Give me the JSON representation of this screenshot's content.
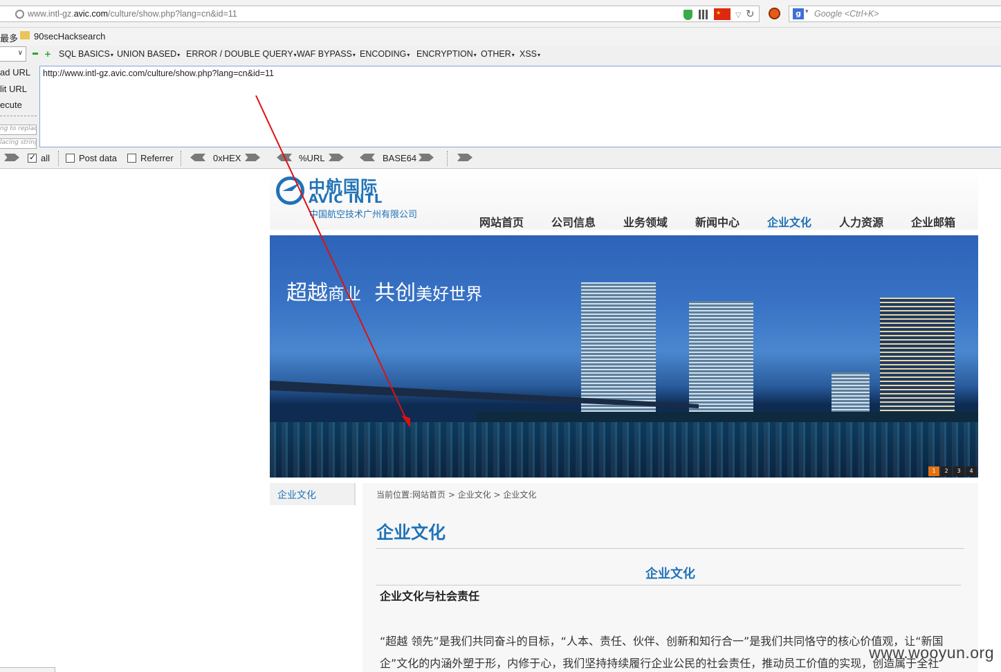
{
  "browser": {
    "url_prefix": "www.intl-gz.",
    "url_domain": "avic.com",
    "url_path": "/culture/show.php?lang=cn&id=11",
    "search_placeholder": "Google <Ctrl+K>",
    "search_engine_icon": "google-icon"
  },
  "bookmarks": {
    "more_label": "最多",
    "items": [
      "90secHacksearch"
    ]
  },
  "hackbar": {
    "menus": [
      "SQL BASICS",
      "UNION BASED",
      "ERROR / DOUBLE QUERY",
      "WAF BYPASS",
      "ENCODING",
      "ENCRYPTION",
      "OTHER",
      "XSS"
    ],
    "side_actions": [
      "ad URL",
      "lit URL",
      "ecute"
    ],
    "find_placeholder": "ng to replac",
    "replace_placeholder": "lacing string",
    "url_value": "http://www.intl-gz.avic.com/culture/show.php?lang=cn&id=11",
    "all_label": "all",
    "all_checked": true,
    "post_label": "Post data",
    "post_checked": false,
    "referrer_label": "Referrer",
    "referrer_checked": false,
    "encoders": [
      "0xHEX",
      "%URL",
      "BASE64"
    ]
  },
  "site": {
    "logo_cn": "中航国际",
    "logo_en": "AVIC INTL",
    "logo_sub": "中国航空技术广州有限公司",
    "nav": [
      "网站首页",
      "公司信息",
      "业务领域",
      "新闻中心",
      "企业文化",
      "人力资源",
      "企业邮箱"
    ],
    "nav_active": "企业文化",
    "banner_slogan_a": "超越",
    "banner_slogan_b": "商业",
    "banner_slogan_c": "共创",
    "banner_slogan_d": "美好世界",
    "slides": [
      "1",
      "2",
      "3",
      "4"
    ],
    "slide_active": 0,
    "left_menu": "企业文化",
    "breadcrumb": "当前位置:网站首页 > 企业文化 > 企业文化",
    "title": "企业文化",
    "article_title": "企业文化",
    "section_heading": "企业文化与社会责任",
    "paragraph": "“超越 领先”是我们共同奋斗的目标，“人本、责任、伙伴、创新和知行合一”是我们共同恪守的核心价值观，让“新国企”文化的内涵外塑于形，内修于心，我们坚持持续履行企业公民的社会责任，推动员工价值的实现，创造属于全社"
  },
  "watermark": "www.wooyun.org",
  "colors": {
    "brand_blue": "#1f72b8",
    "annotation_arrow": "#e01010",
    "slide_active": "#e37215"
  }
}
